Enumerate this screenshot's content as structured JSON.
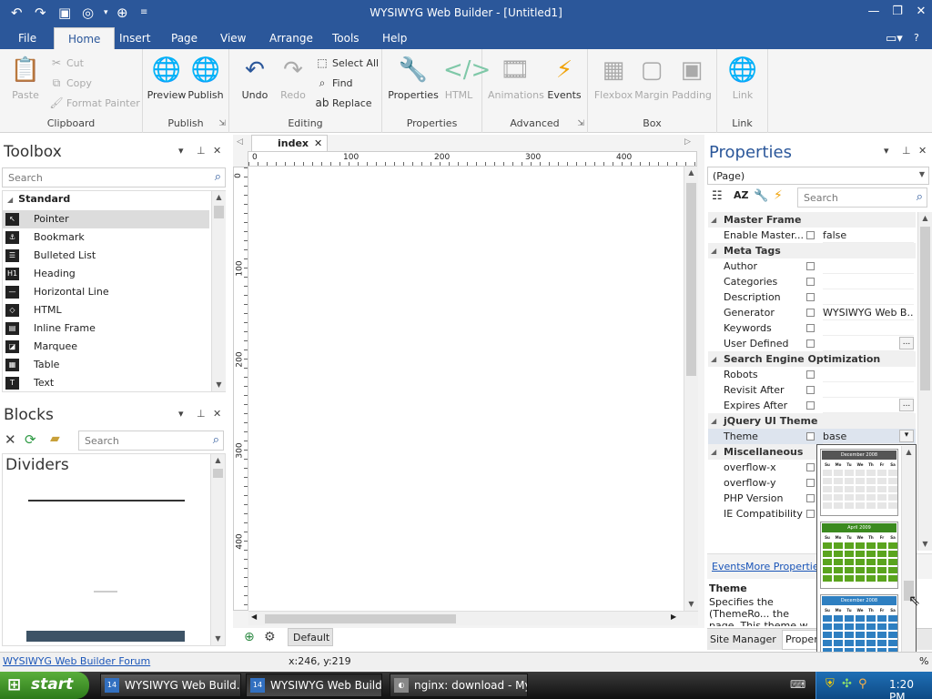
{
  "window": {
    "title": "WYSIWYG Web Builder - [Untitled1]"
  },
  "ribbon_tabs": [
    "File",
    "Home",
    "Insert",
    "Page",
    "View",
    "Arrange",
    "Tools",
    "Help"
  ],
  "ribbon": {
    "clipboard": {
      "paste": "Paste",
      "cut": "Cut",
      "copy": "Copy",
      "format_painter": "Format Painter",
      "label": "Clipboard"
    },
    "publish": {
      "preview": "Preview",
      "publish": "Publish",
      "label": "Publish"
    },
    "editing": {
      "undo": "Undo",
      "redo": "Redo",
      "select_all": "Select All",
      "find": "Find",
      "replace": "Replace",
      "label": "Editing"
    },
    "properties": {
      "properties": "Properties",
      "html": "HTML",
      "label": "Properties"
    },
    "advanced": {
      "animations": "Animations",
      "events": "Events",
      "label": "Advanced"
    },
    "box": {
      "flexbox": "Flexbox",
      "margin": "Margin",
      "padding": "Padding",
      "label": "Box"
    },
    "link": {
      "link": "Link",
      "label": "Link"
    }
  },
  "toolbox": {
    "title": "Toolbox",
    "search_placeholder": "Search",
    "category": "Standard",
    "items": [
      {
        "label": "Pointer",
        "icon": "pointer-icon"
      },
      {
        "label": "Bookmark",
        "icon": "bookmark-icon"
      },
      {
        "label": "Bulleted List",
        "icon": "bulleted-list-icon"
      },
      {
        "label": "Heading",
        "icon": "heading-icon"
      },
      {
        "label": "Horizontal Line",
        "icon": "horizontal-line-icon"
      },
      {
        "label": "HTML",
        "icon": "html-icon"
      },
      {
        "label": "Inline Frame",
        "icon": "inline-frame-icon"
      },
      {
        "label": "Marquee",
        "icon": "marquee-icon"
      },
      {
        "label": "Table",
        "icon": "table-icon"
      },
      {
        "label": "Text",
        "icon": "text-icon"
      }
    ]
  },
  "blocks": {
    "title": "Blocks",
    "search_placeholder": "Search",
    "category": "Dividers"
  },
  "editor": {
    "tab": "index",
    "ruler_h": [
      "0",
      "100",
      "200",
      "300",
      "400"
    ],
    "ruler_v": [
      "0",
      "100",
      "200",
      "300",
      "400"
    ],
    "bottom_tab": "Default"
  },
  "properties": {
    "title": "Properties",
    "object": "(Page)",
    "search_placeholder": "Search",
    "categories": [
      {
        "name": "Master Frame",
        "rows": [
          {
            "name": "Enable Master...",
            "value": "false"
          }
        ]
      },
      {
        "name": "Meta Tags",
        "rows": [
          {
            "name": "Author",
            "value": ""
          },
          {
            "name": "Categories",
            "value": ""
          },
          {
            "name": "Description",
            "value": ""
          },
          {
            "name": "Generator",
            "value": "WYSIWYG Web B..."
          },
          {
            "name": "Keywords",
            "value": ""
          },
          {
            "name": "User Defined",
            "value": ""
          }
        ]
      },
      {
        "name": "Search Engine Optimization",
        "rows": [
          {
            "name": "Robots",
            "value": ""
          },
          {
            "name": "Revisit After",
            "value": ""
          },
          {
            "name": "Expires After",
            "value": ""
          }
        ]
      },
      {
        "name": "jQuery UI Theme",
        "rows": [
          {
            "name": "Theme",
            "value": "base"
          }
        ]
      },
      {
        "name": "Miscellaneous",
        "rows": [
          {
            "name": "overflow-x",
            "value": ""
          },
          {
            "name": "overflow-y",
            "value": ""
          },
          {
            "name": "PHP Version",
            "value": ""
          },
          {
            "name": "IE Compatibility",
            "value": ""
          }
        ]
      }
    ],
    "links": {
      "events": "Events",
      "more": "More Properties"
    },
    "help_title": "Theme",
    "help_text": "Specifies the (ThemeRo... the page. This theme w... theme enabled objects",
    "bottom_tabs": [
      "Site Manager",
      "Properties"
    ]
  },
  "theme_previews": [
    {
      "header": "December 2008",
      "color": "#555555",
      "cell": "#e6e6e6",
      "cell_text": "#555555"
    },
    {
      "header": "April 2009",
      "color": "#3b8a1f",
      "cell": "#5aa41e",
      "cell_text": "#ffffff"
    },
    {
      "header": "December 2008",
      "color": "#2e7fc1",
      "cell": "#2e7fc1",
      "cell_text": "#ffffff"
    }
  ],
  "calendar_days": [
    "Su",
    "Mo",
    "Tu",
    "We",
    "Th",
    "Fr",
    "Sa"
  ],
  "status": {
    "forum_link": "WYSIWYG Web Builder Forum",
    "coords": "x:246, y:219",
    "zoom_tail": "%"
  },
  "taskbar": {
    "start": "start",
    "buttons": [
      "WYSIWYG Web Build...",
      "WYSIWYG Web Build...",
      "nginx: download - My..."
    ],
    "clock": "1:20 PM"
  }
}
